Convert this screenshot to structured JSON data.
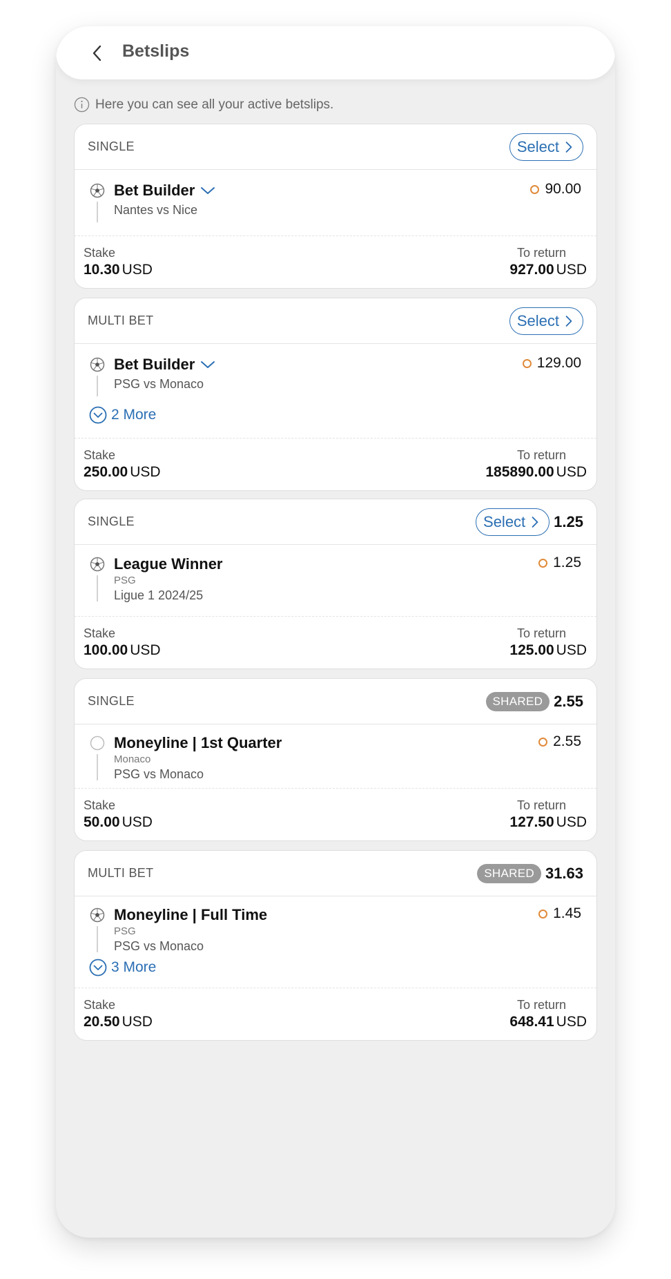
{
  "header": {
    "title": "Betslips"
  },
  "info": {
    "text": "Here you can see all your active betslips."
  },
  "colors": {
    "accent": "#2b6fb3",
    "odds_marker": "#e08a3a",
    "shared_badge": "#9a9a9a"
  },
  "labels": {
    "stake": "Stake",
    "to_return": "To return",
    "select": "Select",
    "shared": "SHARED"
  },
  "betslips": [
    {
      "type": "SINGLE",
      "selection": {
        "title": "Bet Builder",
        "subtitle_small": "",
        "subtitle": "Nantes vs Nice",
        "odds": "90.00",
        "icon": "soccer-ball-icon"
      },
      "stake": {
        "amount": "10.30",
        "currency": "USD"
      },
      "to_return": {
        "amount": "927.00",
        "currency": "USD"
      }
    },
    {
      "type": "MULTI BET",
      "selection": {
        "title": "Bet Builder",
        "subtitle_small": "",
        "subtitle": "PSG vs Monaco",
        "odds": "129.00",
        "icon": "soccer-ball-icon"
      },
      "more": "2 More",
      "stake": {
        "amount": "250.00",
        "currency": "USD"
      },
      "to_return": {
        "amount": "185890.00",
        "currency": "USD"
      }
    },
    {
      "type": "SINGLE",
      "head_odds": "1.25",
      "selection": {
        "title": "League Winner",
        "subtitle_small": "PSG",
        "subtitle": "Ligue 1 2024/25",
        "odds": "1.25",
        "icon": "soccer-ball-icon"
      },
      "stake": {
        "amount": "100.00",
        "currency": "USD"
      },
      "to_return": {
        "amount": "125.00",
        "currency": "USD"
      }
    },
    {
      "type": "SINGLE",
      "head_odds": "2.55",
      "selection": {
        "title": "Moneyline | 1st Quarter",
        "subtitle_small": "Monaco",
        "subtitle": "PSG vs Monaco",
        "odds": "2.55",
        "icon": "empty-circle-icon"
      },
      "stake": {
        "amount": "50.00",
        "currency": "USD"
      },
      "to_return": {
        "amount": "127.50",
        "currency": "USD"
      }
    },
    {
      "type": "MULTI BET",
      "head_odds": "31.63",
      "selection": {
        "title": "Moneyline | Full Time",
        "subtitle_small": "PSG",
        "subtitle": "PSG vs Monaco",
        "odds": "1.45",
        "icon": "soccer-ball-icon"
      },
      "more": "3 More",
      "stake": {
        "amount": "20.50",
        "currency": "USD"
      },
      "to_return": {
        "amount": "648.41",
        "currency": "USD"
      }
    }
  ]
}
